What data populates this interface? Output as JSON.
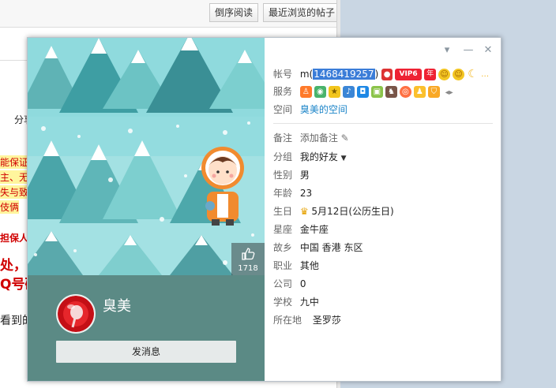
{
  "background": {
    "buttons": [
      "倒序阅读",
      "最近浏览的帖子"
    ],
    "peek_texts": [
      {
        "text": "分享",
        "color": "#222"
      },
      {
        "text": "能保证",
        "color": "#d00000"
      },
      {
        "text": "主、无",
        "color": "#d00000"
      },
      {
        "text": "失与致",
        "color": "#d00000"
      },
      {
        "text": "伎俩",
        "color": "#d00000"
      },
      {
        "text": "担保人",
        "color": "#d00000"
      },
      {
        "text": "处，",
        "color": "#d00000"
      },
      {
        "text": "Q号码",
        "color": "#d00000"
      },
      {
        "text": "看到的",
        "color": "#222"
      }
    ]
  },
  "card": {
    "likes": "1718",
    "nickname": "臭美",
    "send_message_label": "发消息",
    "account": {
      "label": "帐号",
      "prefix": "m(",
      "number": "1468419257",
      "suffix": ")",
      "vip_label": "VIP6",
      "year_label": "年"
    },
    "services_label": "服务",
    "space": {
      "label": "空间",
      "link": "臭美的空间"
    },
    "remark": {
      "label": "备注",
      "value": "添加备注"
    },
    "group": {
      "label": "分组",
      "value": "我的好友"
    },
    "gender": {
      "label": "性别",
      "value": "男"
    },
    "age": {
      "label": "年龄",
      "value": "23"
    },
    "birthday": {
      "label": "生日",
      "value": "5月12日(公历生日)"
    },
    "zodiac": {
      "label": "星座",
      "value": "金牛座"
    },
    "hometown": {
      "label": "故乡",
      "value": "中国 香港 东区"
    },
    "job": {
      "label": "职业",
      "value": "其他"
    },
    "company": {
      "label": "公司",
      "value": "0"
    },
    "school": {
      "label": "学校",
      "value": "九中"
    },
    "location": {
      "label": "所在地",
      "value": "圣罗莎"
    }
  },
  "colors": {
    "accent": "#1b84c8",
    "panel": "#5b8a85",
    "sky": "#8fdadd"
  }
}
